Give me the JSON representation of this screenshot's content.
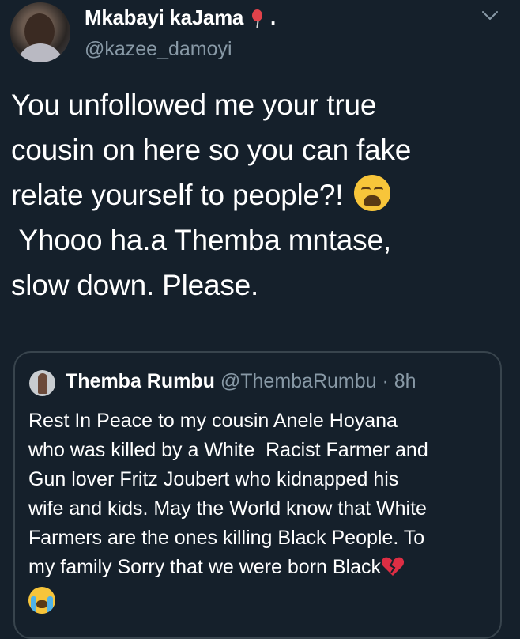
{
  "tweet": {
    "display_name": "Mkabayi kaJama",
    "name_suffix": ".",
    "handle": "@kazee_damoyi",
    "text_lines": [
      "You unfollowed me your true",
      "cousin on here so you can fake",
      "relate yourself to people?!",
      " Yhooo ha.a Themba mntase,",
      "slow down. Please."
    ]
  },
  "quoted": {
    "display_name": "Themba Rumbu",
    "handle": "@ThembaRumbu",
    "separator": "·",
    "time": "8h",
    "text_lines": [
      "Rest In Peace to my cousin Anele Hoyana",
      "who was killed by a White  Racist Farmer and",
      "Gun lover Fritz Joubert who kidnapped his",
      "wife and kids. May the World know that White",
      "Farmers are the ones killing Black People. To",
      "my family Sorry that we were born Black"
    ]
  },
  "icons": {
    "name_emoji": "balloon-icon",
    "menu": "chevron-down-icon",
    "tweet_emoji": "weary-face-icon",
    "quote_emoji_1": "broken-heart-icon",
    "quote_emoji_2": "loudly-crying-face-icon"
  },
  "colors": {
    "background": "#15202b",
    "text": "#ffffff",
    "secondary_text": "#8899a6",
    "border": "#38444d"
  }
}
